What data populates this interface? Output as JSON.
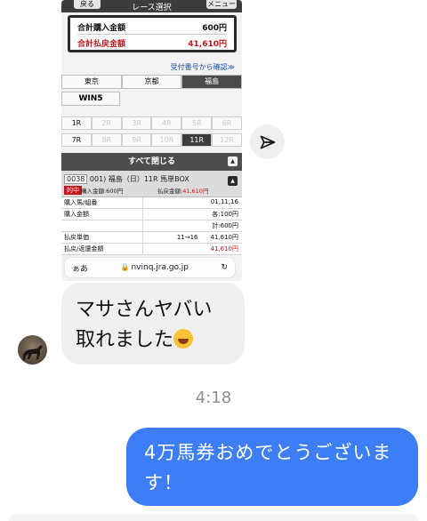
{
  "screenshot": {
    "header": {
      "back_label": "戻る",
      "title": "レース選択",
      "menu_label": "メニュー"
    },
    "summary": {
      "purchase_label": "合計購入金額",
      "purchase_value": "600円",
      "payout_label": "合計払戻金額",
      "payout_value": "41,610円"
    },
    "confirm_link": "受付番号から確認≫",
    "venue_tabs": [
      "東京",
      "京都",
      "福島"
    ],
    "win5_label": "WIN5",
    "race_row1": [
      "1R",
      "2R",
      "3R",
      "4R",
      "5R",
      "6R"
    ],
    "race_row2": [
      "7R",
      "8R",
      "9R",
      "10R",
      "11R",
      "12R"
    ],
    "close_all_label": "すべて閉じる",
    "bet": {
      "line1_code": "0038",
      "line1_text": "001) 福島（日）11R 馬単BOX",
      "hit_badge": "的中",
      "buy_text": "購入金額:600円",
      "pay_label": "払戻金額:",
      "pay_value": "41,610円"
    },
    "detail_rows": [
      {
        "label": "購入馬/組番",
        "value": "01,11,16",
        "red": false
      },
      {
        "label": "購入金額",
        "value": "各:100円",
        "red": false
      },
      {
        "label": "",
        "value": "計:600円",
        "red": false
      },
      {
        "label": "払戻単価",
        "value": "11→16　　41,610円",
        "red": false
      },
      {
        "label": "払戻/返還金額",
        "value": "41,610円",
        "red": true
      }
    ],
    "url_bar": {
      "aa_label": "ぁあ",
      "url": "nvinq.jra.go.jp"
    }
  },
  "icons": {
    "share": "send-arrow-icon",
    "reload": "reload-icon",
    "lock": "lock-icon",
    "emoji": "rolling-on-floor-laughing-emoji"
  },
  "chat": {
    "incoming_text_line1": "マサさんヤバい",
    "incoming_text_line2": "取れました",
    "timestamp": "4:18",
    "outgoing_text": "4万馬券おめでとうございます！"
  },
  "colors": {
    "outgoing_bubble": "#3d7df6",
    "incoming_bubble": "#efefef",
    "accent_red": "#c4161c"
  }
}
